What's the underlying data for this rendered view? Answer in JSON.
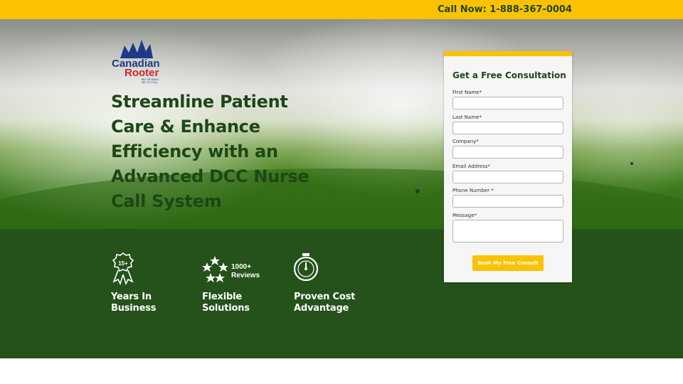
{
  "topbar": {
    "phone_text": "Call Now: 1-888-367-0004"
  },
  "logo": {
    "line1": "Canadian",
    "line2": "Rooter",
    "tagline1": "BIG OR SMALL",
    "tagline2": "WE FIX IT ALL"
  },
  "hero": {
    "headline": "Streamline Patient Care & Enhance Efficiency with an Advanced DCC Nurse Call System"
  },
  "features": [
    {
      "icon": "award-ribbon-icon",
      "badge": "15+",
      "label": "Years In\nBusiness"
    },
    {
      "icon": "stars-icon",
      "badge_line1": "1000+",
      "badge_line2": "Reviews",
      "label": "Flexible\nSolutions"
    },
    {
      "icon": "stopwatch-icon",
      "label": "Proven Cost\nAdvantage"
    }
  ],
  "form": {
    "title": "Get a Free Consultation",
    "fields": [
      {
        "label": "First Name*",
        "value": ""
      },
      {
        "label": "Last Name*",
        "value": ""
      },
      {
        "label": "Company*",
        "value": ""
      },
      {
        "label": "Email Address*",
        "value": ""
      },
      {
        "label": "Phone Number *",
        "value": ""
      },
      {
        "label": "Message*",
        "value": ""
      }
    ],
    "submit_label": "Book My Free Consult"
  },
  "colors": {
    "brand_green": "#1d4716",
    "band_green": "#24521a",
    "accent_yellow": "#fbc203"
  }
}
